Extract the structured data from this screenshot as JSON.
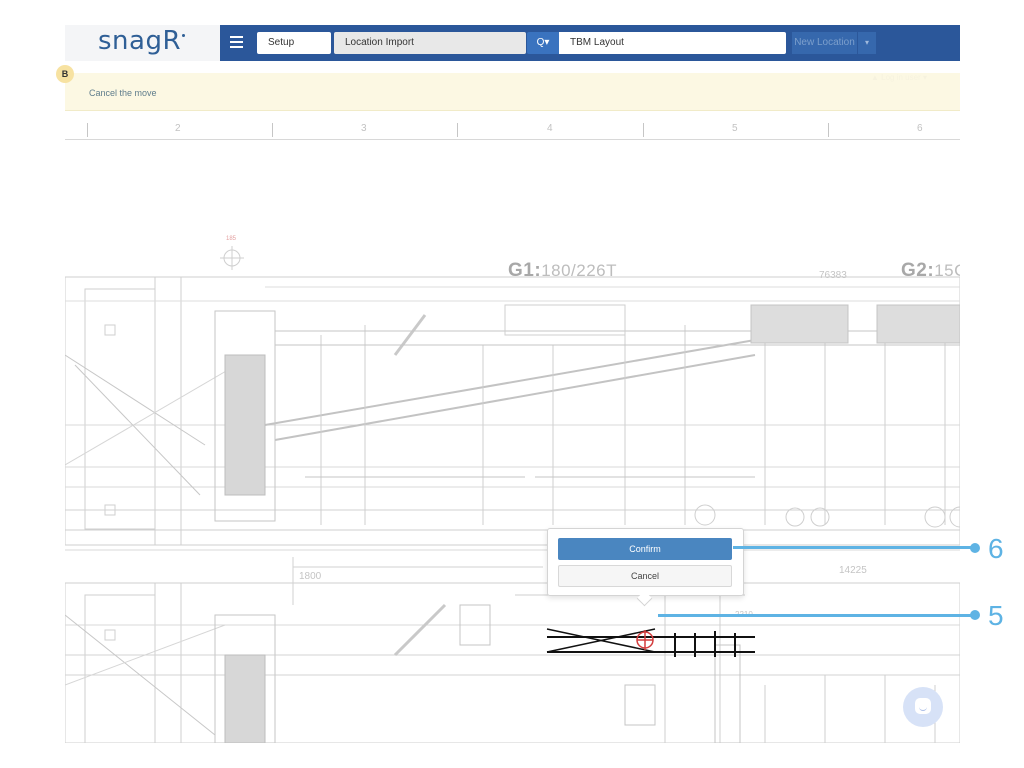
{
  "app": {
    "logo": "snagR"
  },
  "navbar": {
    "setup_label": "Setup",
    "import_label": "Location Import",
    "search_label": "Q▾",
    "layout_value": "TBM Layout",
    "new_location_label": "New Location",
    "caret": "▾"
  },
  "banner": {
    "message": "Cancel the move",
    "user_label": "▲ Log in user ▾",
    "badge": "B"
  },
  "ruler": {
    "numbers": [
      "2",
      "3",
      "4",
      "5",
      "6"
    ]
  },
  "drawing": {
    "g1_code": "G1:",
    "g1_value": "180/226T",
    "g2_code": "G2:",
    "g2_value": "15C",
    "number_76383": "76383",
    "dim_1800": "1800",
    "dim_14225": "14225",
    "dim_210": "2210",
    "marker_number": "185"
  },
  "popover": {
    "confirm_label": "Confirm",
    "cancel_label": "Cancel"
  },
  "callouts": {
    "six": "6",
    "five": "5"
  },
  "colors": {
    "navbar": "#2b579a",
    "banner": "#fcf8e3",
    "confirm": "#4a86c0",
    "callout": "#5eb3e4",
    "marker": "#d23c3c"
  }
}
